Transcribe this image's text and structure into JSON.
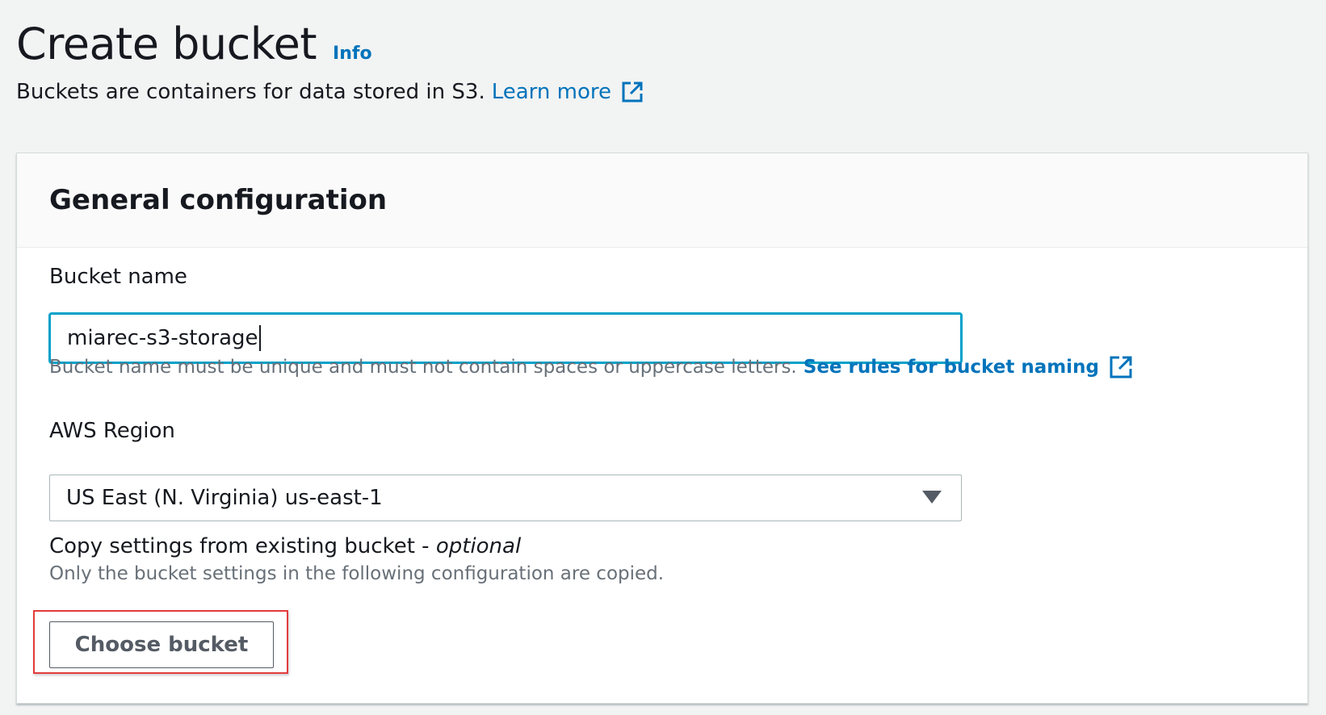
{
  "header": {
    "title": "Create bucket",
    "info_link": "Info",
    "description": "Buckets are containers for data stored in S3.",
    "learn_more": "Learn more"
  },
  "general_configuration": {
    "title": "General configuration",
    "bucket_name": {
      "label": "Bucket name",
      "value": "miarec-s3-storage",
      "hint": "Bucket name must be unique and must not contain spaces or uppercase letters.",
      "rules_link": "See rules for bucket naming"
    },
    "region": {
      "label": "AWS Region",
      "selected": "US East (N. Virginia) us-east-1"
    },
    "copy_settings": {
      "label": "Copy settings from existing bucket -",
      "optional": "optional",
      "hint": "Only the bucket settings in the following configuration are copied.",
      "button": "Choose bucket"
    }
  },
  "colors": {
    "link": "#0073bb",
    "focus": "#00a1c9",
    "highlight": "#e23c3c",
    "background": "#f2f3f3"
  },
  "icons": [
    "external-link-icon",
    "dropdown-caret-icon"
  ]
}
